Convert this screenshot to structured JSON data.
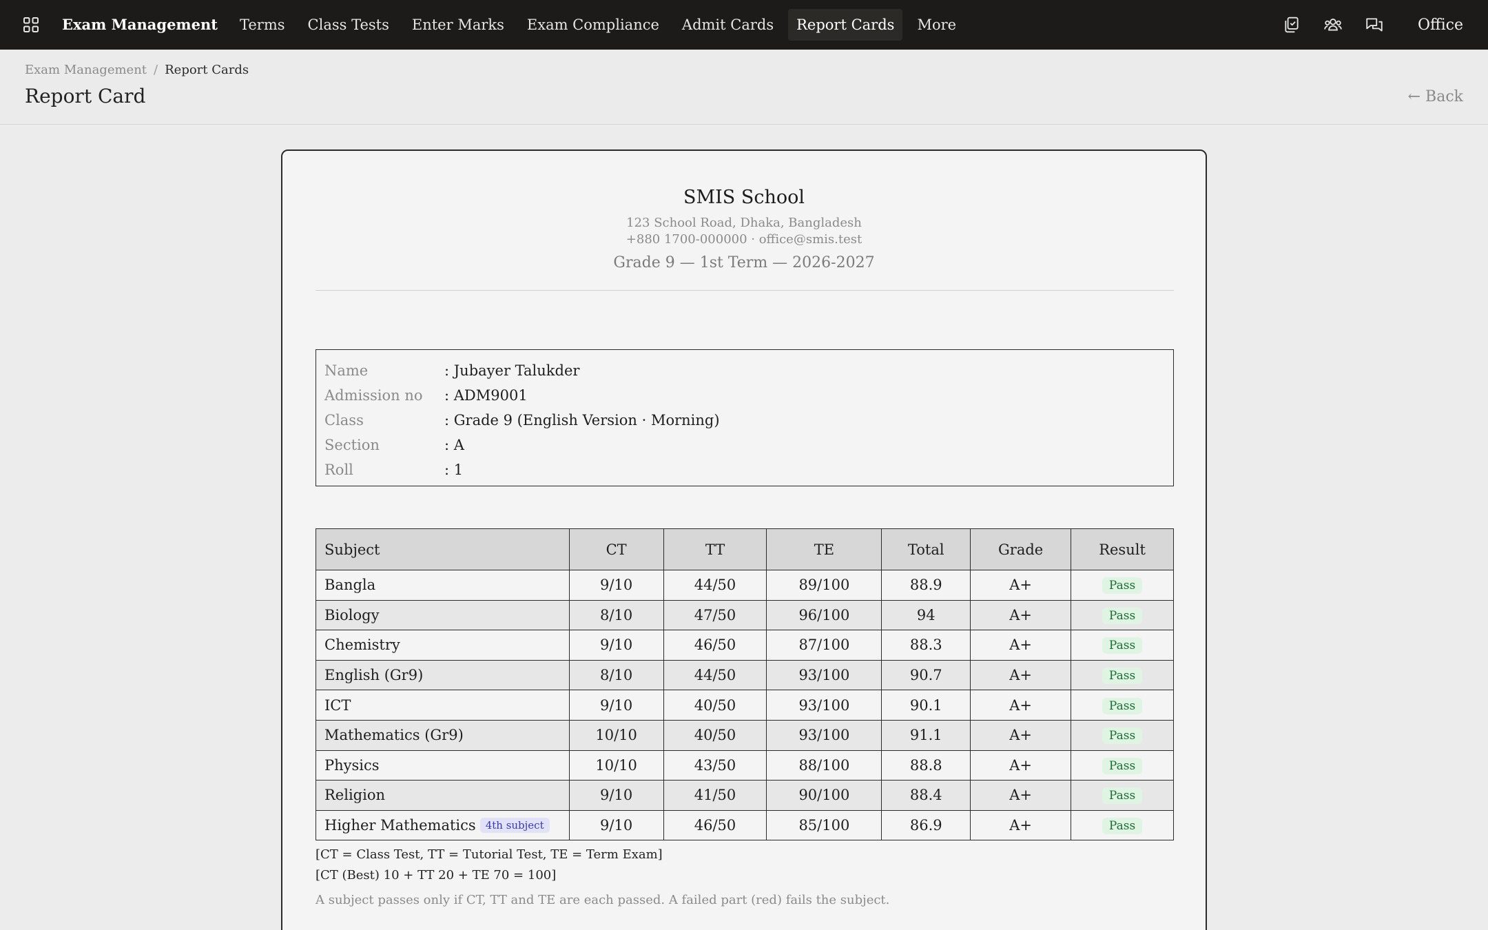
{
  "nav": {
    "brand": "Exam Management",
    "items": [
      "Terms",
      "Class Tests",
      "Enter Marks",
      "Exam Compliance",
      "Admit Cards",
      "Report Cards",
      "More"
    ],
    "active": "Report Cards",
    "office": "Office"
  },
  "header": {
    "breadcrumb": [
      "Exam Management",
      "Report Cards"
    ],
    "title": "Report Card",
    "back": "← Back"
  },
  "school": {
    "name": "SMIS School",
    "address": "123 School Road, Dhaka, Bangladesh",
    "contact": "+880 1700-000000 · office@smis.test",
    "term": "Grade 9 — 1st Term — 2026-2027"
  },
  "student": {
    "fields": [
      {
        "label": "Name",
        "value": ": Jubayer Talukder"
      },
      {
        "label": "Admission no",
        "value": ": ADM9001"
      },
      {
        "label": "Class",
        "value": ": Grade 9 (English Version · Morning)"
      },
      {
        "label": "Section",
        "value": ": A"
      },
      {
        "label": "Roll",
        "value": ": 1"
      }
    ]
  },
  "marks": {
    "columns": [
      "Subject",
      "CT",
      "TT",
      "TE",
      "Total",
      "Grade",
      "Result"
    ],
    "rows": [
      {
        "subject": "Bangla",
        "ct": "9/10",
        "tt": "44/50",
        "te": "89/100",
        "total": "88.9",
        "grade": "A+",
        "result": "Pass"
      },
      {
        "subject": "Biology",
        "ct": "8/10",
        "tt": "47/50",
        "te": "96/100",
        "total": "94",
        "grade": "A+",
        "result": "Pass"
      },
      {
        "subject": "Chemistry",
        "ct": "9/10",
        "tt": "46/50",
        "te": "87/100",
        "total": "88.3",
        "grade": "A+",
        "result": "Pass"
      },
      {
        "subject": "English (Gr9)",
        "ct": "8/10",
        "tt": "44/50",
        "te": "93/100",
        "total": "90.7",
        "grade": "A+",
        "result": "Pass"
      },
      {
        "subject": "ICT",
        "ct": "9/10",
        "tt": "40/50",
        "te": "93/100",
        "total": "90.1",
        "grade": "A+",
        "result": "Pass"
      },
      {
        "subject": "Mathematics (Gr9)",
        "ct": "10/10",
        "tt": "40/50",
        "te": "93/100",
        "total": "91.1",
        "grade": "A+",
        "result": "Pass"
      },
      {
        "subject": "Physics",
        "ct": "10/10",
        "tt": "43/50",
        "te": "88/100",
        "total": "88.8",
        "grade": "A+",
        "result": "Pass"
      },
      {
        "subject": "Religion",
        "ct": "9/10",
        "tt": "41/50",
        "te": "90/100",
        "total": "88.4",
        "grade": "A+",
        "result": "Pass"
      },
      {
        "subject": "Higher Mathematics",
        "badge": "4th subject",
        "ct": "9/10",
        "tt": "46/50",
        "te": "85/100",
        "total": "86.9",
        "grade": "A+",
        "result": "Pass"
      }
    ]
  },
  "notes": {
    "legend": "[CT = Class Test, TT = Tutorial Test, TE = Term Exam]",
    "formula": "[CT (Best) 10 + TT 20 + TE 70 = 100]",
    "rule": "A subject passes only if CT, TT and TE are each passed. A failed part (red) fails the subject."
  },
  "colors": {
    "topbar": "#1c1b19",
    "pass_bg": "#e0f4e4",
    "pass_text": "#1d6b35",
    "badge_bg": "#e1e1f8",
    "badge_text": "#3a3aa6"
  }
}
